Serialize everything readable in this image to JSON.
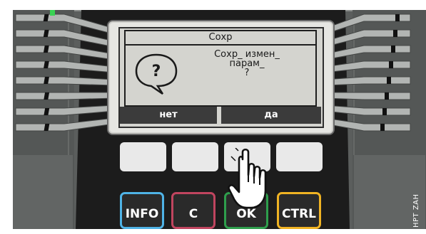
{
  "dialog": {
    "title": "Сохр",
    "message_lines": [
      "Сохр_ измен_",
      "парам_",
      "?"
    ],
    "icon": "question-bubble-icon"
  },
  "softkeys": {
    "left_label": "нет",
    "right_label": "да"
  },
  "panel_keys": {
    "info_label": "INFO",
    "c_label": "C",
    "ok_label": "OK",
    "ctrl_label": "CTRL"
  },
  "side_label": "HPT ZAH",
  "colors": {
    "lcd_background": "#d4d4cf",
    "device_dark": "#1c1c1c",
    "device_panel": "#5b5e5d",
    "led_green": "#39d353",
    "info_key_ring": "#4fb3e6",
    "c_key_ring": "#c0455f",
    "ok_key_ring": "#2e9e4c",
    "ctrl_key_ring": "#f0b323"
  },
  "icons": [
    "question-bubble-icon",
    "pointing-hand-icon",
    "status-led-icon"
  ]
}
